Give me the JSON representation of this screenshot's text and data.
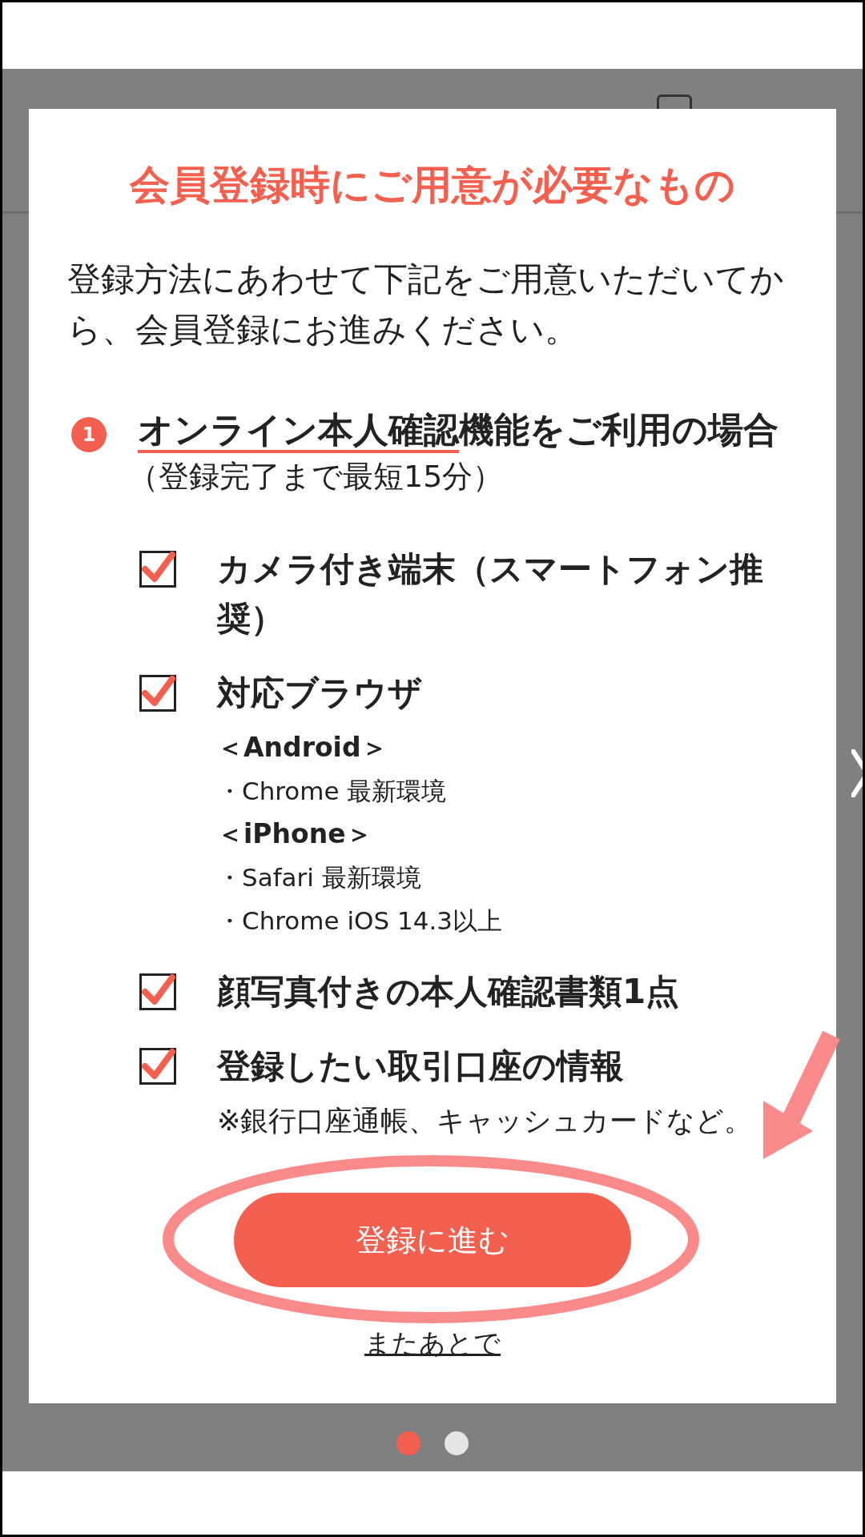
{
  "modal": {
    "title": "会員登録時にご用意が必要なもの",
    "intro": "登録方法にあわせて下記をご用意いただいてから、会員登録にお進みください。",
    "section": {
      "number": "1",
      "heading_underlined": "オンライン本人確認",
      "heading_rest": "機能をご利用の場合",
      "subtitle": "（登録完了まで最短15分）"
    },
    "items": [
      {
        "label": "カメラ付き端末（スマートフォン推奨）",
        "checked": true
      },
      {
        "label": "対応ブラウザ",
        "checked": true,
        "details": [
          {
            "kind": "heading",
            "text": "＜Android＞"
          },
          {
            "kind": "bullet",
            "text": "・Chrome 最新環境"
          },
          {
            "kind": "heading",
            "text": "＜iPhone＞"
          },
          {
            "kind": "bullet",
            "text": "・Safari 最新環境"
          },
          {
            "kind": "bullet",
            "text": "・Chrome iOS 14.3以上"
          }
        ]
      },
      {
        "label": "顔写真付きの本人確認書類1点",
        "checked": true
      },
      {
        "label": "登録したい取引口座の情報",
        "checked": true,
        "details": [
          {
            "kind": "note",
            "text": "※銀行口座通帳、キャッシュカードなど。"
          }
        ]
      }
    ],
    "primary_button": "登録に進む",
    "later_link": "またあとで"
  },
  "pager": [
    {
      "selected": true
    },
    {
      "selected": false
    }
  ]
}
